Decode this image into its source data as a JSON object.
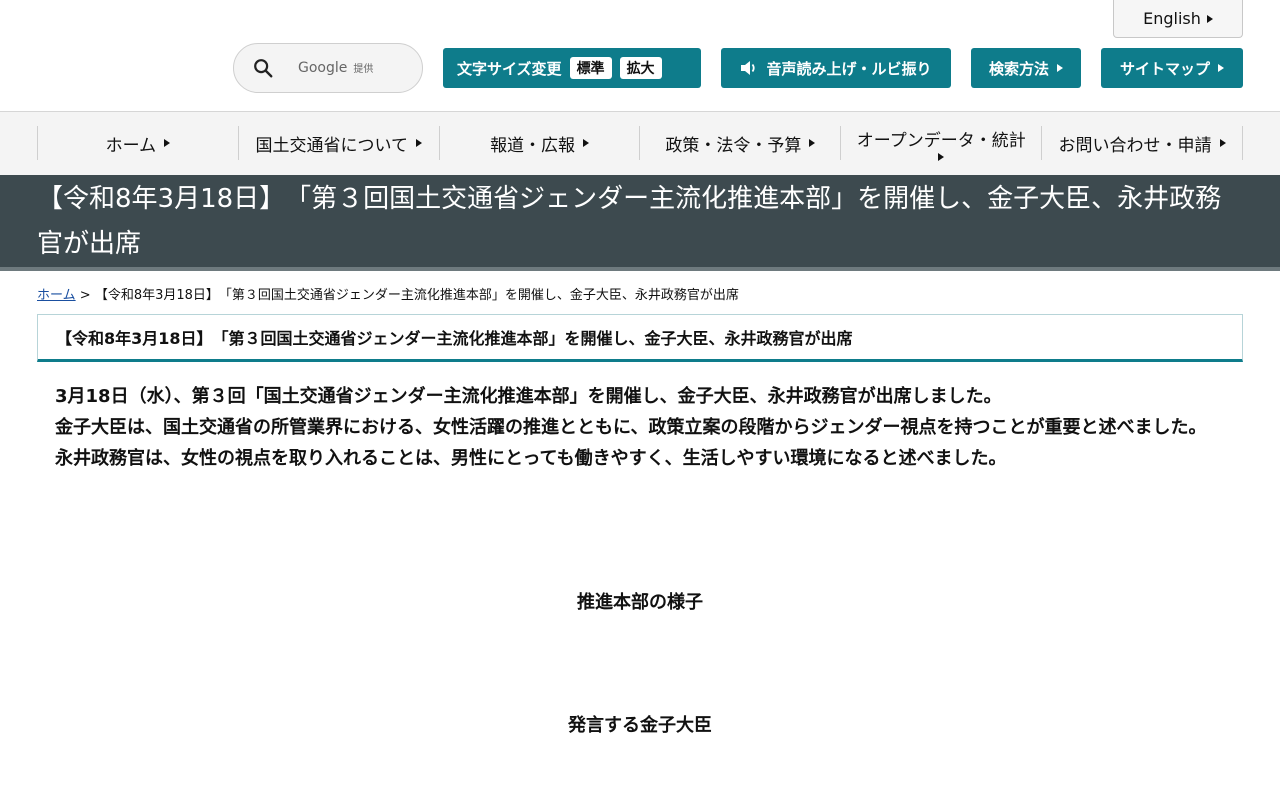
{
  "header": {
    "lang_label": "English",
    "search": {
      "brand": "Google",
      "provider": "提供"
    },
    "font_size": {
      "label": "文字サイズ変更",
      "standard": "標準",
      "large": "拡大"
    },
    "voice_label": "音声読み上げ・ルビ振り",
    "search_method_label": "検索方法",
    "sitemap_label": "サイトマップ",
    "accent_color": "#0e7c8b"
  },
  "nav": {
    "items": [
      {
        "label": "ホーム"
      },
      {
        "label": "国土交通省について"
      },
      {
        "label": "報道・広報"
      },
      {
        "label": "政策・法令・予算"
      },
      {
        "label": "オープンデータ・統計"
      },
      {
        "label": "お問い合わせ・申請"
      }
    ]
  },
  "page": {
    "title": "【令和8年3月18日】　「第３回国土交通省ジェンダー主流化推進本部」を開催し、金子大臣、永井政務官が出席",
    "band_color": "#3d4a4f"
  },
  "breadcrumb": {
    "home": "ホーム",
    "separator": ">",
    "current": "【令和8年3月18日】　「第３回国土交通省ジェンダー主流化推進本部」を開催し、金子大臣、永井政務官が出席"
  },
  "article": {
    "heading": "【令和8年3月18日】　「第３回国土交通省ジェンダー主流化推進本部」を開催し、金子大臣、永井政務官が出席",
    "paragraphs": [
      "3月18日（水）、第３回「国土交通省ジェンダー主流化推進本部」を開催し、金子大臣、永井政務官が出席しました。",
      "金子大臣は、国土交通省の所管業界における、女性活躍の推進とともに、政策立案の段階からジェンダー視点を持つことが重要と述べました。",
      "永井政務官は、女性の視点を取り入れることは、男性にとっても働きやすく、生活しやすい環境になると述べました。"
    ],
    "captions": [
      "推進本部の様子",
      "発言する金子大臣"
    ]
  }
}
